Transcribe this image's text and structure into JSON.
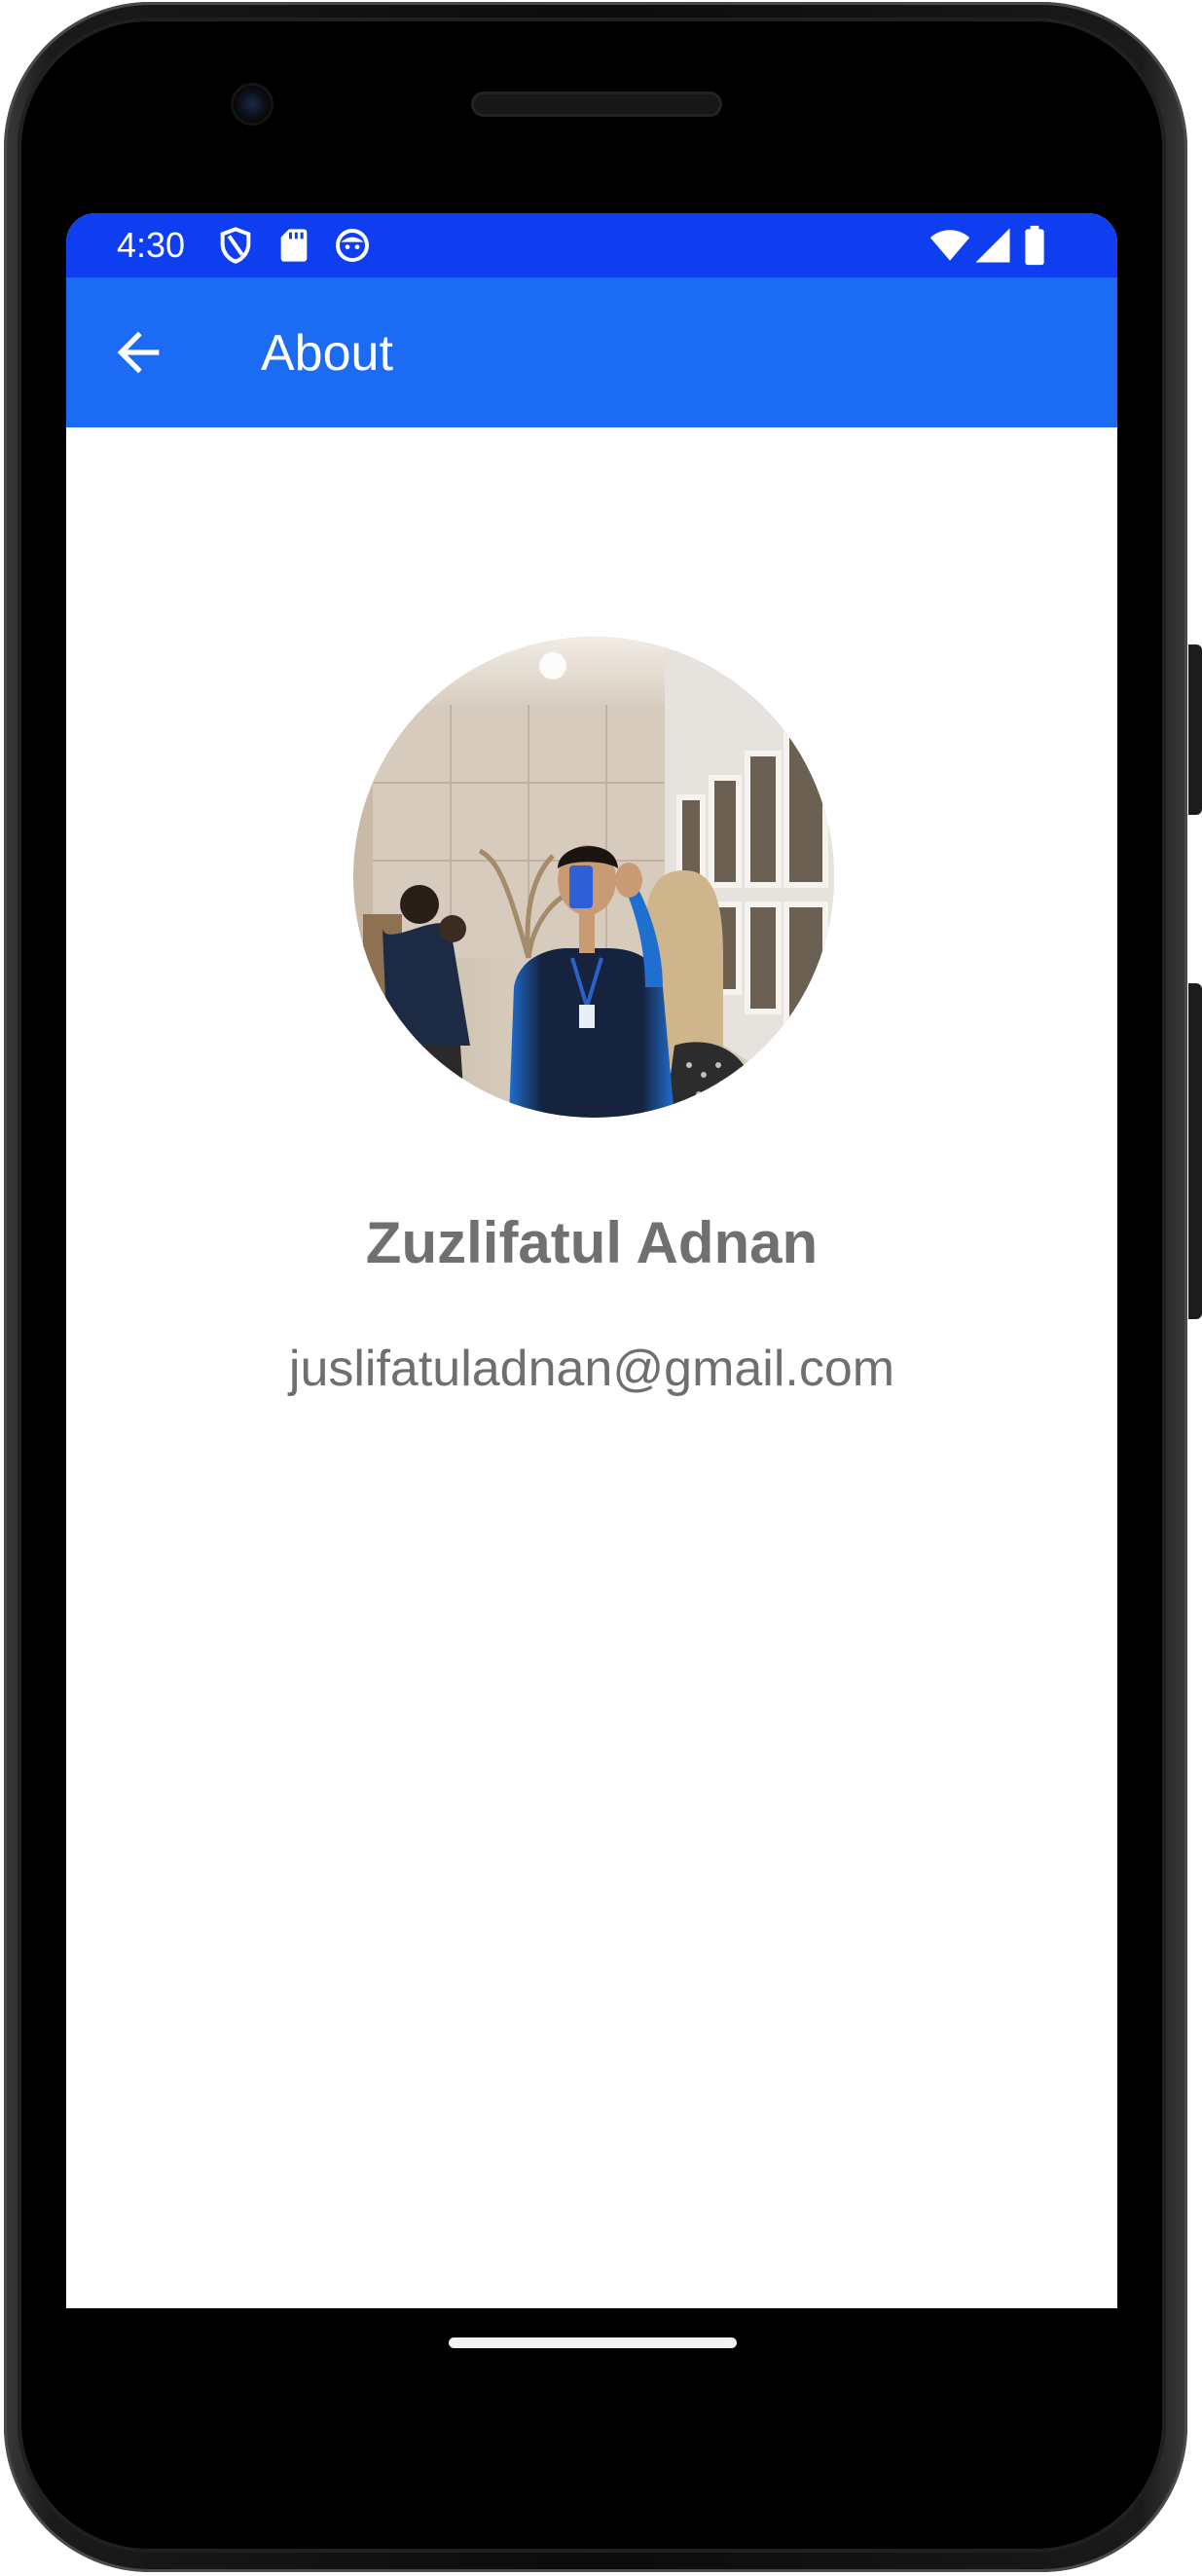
{
  "status_bar": {
    "time": "4:30",
    "left_icons": [
      "shield-icon",
      "sd-card-icon",
      "face-icon"
    ],
    "right_icons": [
      "wifi-icon",
      "cell-signal-icon",
      "battery-icon"
    ],
    "color": "#0e3ef0"
  },
  "app_bar": {
    "title": "About",
    "back_icon": "arrow-back-icon",
    "color": "#1c6bf5"
  },
  "profile": {
    "photo": "profile-photo",
    "name": "Zuzlifatul Adnan",
    "email": "juslifatuladnan@gmail.com"
  },
  "theme": {
    "text_gray": "#707070",
    "background": "#ffffff"
  }
}
